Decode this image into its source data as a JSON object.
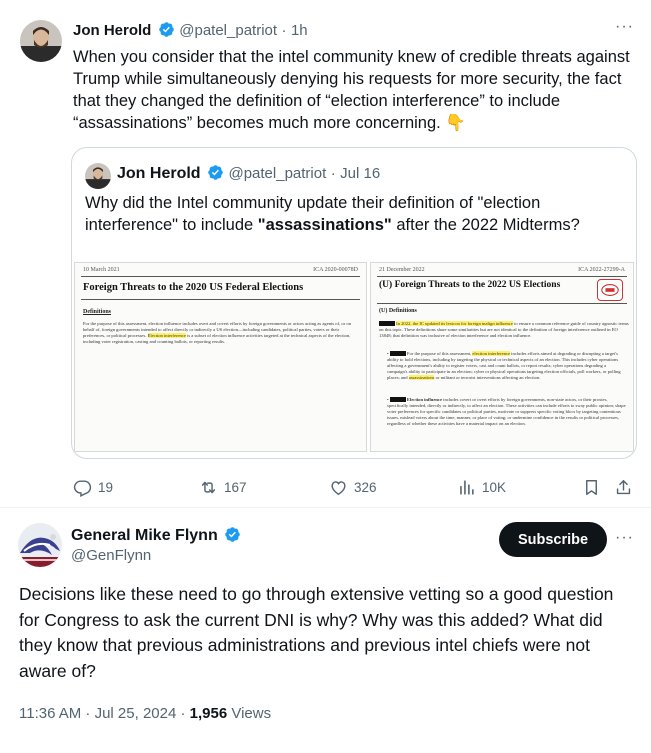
{
  "tweet": {
    "author_name": "Jon Herold",
    "handle": "@patel_patriot",
    "separator": "·",
    "time": "1h",
    "more": "···",
    "text": "When you consider that the intel community knew of credible threats against Trump while simultaneously denying his requests for more security, the fact that they changed the definition of “election interference” to include “assassinations” becomes much more concerning. 👇",
    "quote": {
      "author_name": "Jon Herold",
      "handle": "@patel_patriot",
      "separator": "·",
      "time": "Jul 16",
      "text_pre": "Why did the Intel community update their definition of \"election interference\" to include ",
      "text_bold": "\"assassinations\"",
      "text_post": " after the 2022 Midterms?",
      "doc_left": {
        "date": "10 March 2021",
        "ref": "ICA 2020-00078D",
        "title": "Foreign Threats to the 2020 US Federal Elections",
        "section": "Definitions",
        "para_pre": "For the purpose of this assessment, election influence includes overt and covert efforts by foreign governments or actors acting as agents of, or on behalf of, foreign governments intended to affect directly or indirectly a US election—including candidates, political parties, voters or their preferences, or political processes. ",
        "para_hl": "Election interference",
        "para_post": " is a subset of election influence activities targeted at the technical aspects of the election, including voter registration, casting and counting ballots, or reporting results."
      },
      "doc_right": {
        "date": "21 December 2022",
        "ref": "ICA 2022-27299-A",
        "title": "(U) Foreign Threats to the 2022 US Elections",
        "section": "(U) Definitions",
        "p1_hl": "In 2022, the IC updated its lexicon for foreign malign influence",
        "p1_post": " to ensure a common reference guide of country agnostic terms on this topic. These definitions share some similarities but are not identical to the definition of foreign interference outlined in EO 13848; that definition was inclusive of election interference and election influence.",
        "p2_pre": "For the purpose of this assessment, ",
        "p2_hl": "election interference",
        "p2_mid": " includes efforts aimed at degrading or disrupting a target's ability to hold elections, including by targeting the physical or technical aspects of an election. This includes cyber operations affecting a government's ability to register voters, cast and count ballots, or report results; cyber operations degrading a campaign's ability to participate in an election; cyber or physical operations targeting election officials, poll workers, or polling places; and ",
        "p2_hl2": "assassinations",
        "p2_post": " or militant or terrorist interventions affecting an election.",
        "p3_bold": "Election influence",
        "p3_post": " includes covert or overt efforts by foreign governments, non-state actors, or their proxies, specifically intended, directly or indirectly, to affect an election. These activities can include efforts to sway public opinion; shape voter preferences for specific candidates or political parties, motivate or suppress specific voting blocs by targeting contentious issues, mislead voters about the time, manner, or place of voting; or undermine confidence in the results or political processes, regardless of whether these activities have a material impact on an election."
      }
    },
    "actions": {
      "replies": "19",
      "reposts": "167",
      "likes": "326",
      "views": "10K"
    }
  },
  "reply": {
    "author_name": "General Mike Flynn",
    "handle": "@GenFlynn",
    "subscribe_label": "Subscribe",
    "more": "···",
    "text": "Decisions like these need to go through extensive vetting so a good question for Congress to ask the current DNI is why? Why was this added? What did they know that previous administrations and previous intel chiefs were not aware of?",
    "time": "11:36 AM · Jul 25, 2024 · ",
    "views_count": "1,956",
    "views_label": " Views"
  },
  "colors": {
    "verified": "#1d9bf0",
    "muted": "#536471",
    "text": "#0f1419",
    "highlight": "#fff26a"
  }
}
